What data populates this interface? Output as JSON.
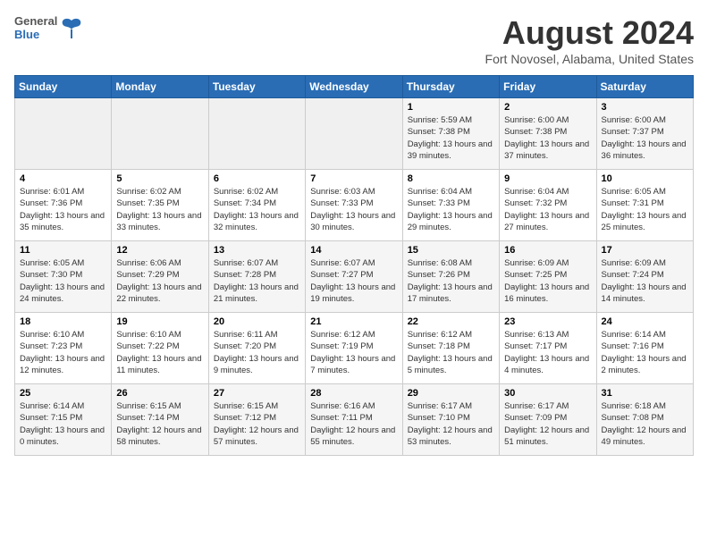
{
  "header": {
    "logo_line1": "General",
    "logo_line2": "Blue",
    "month": "August 2024",
    "location": "Fort Novosel, Alabama, United States"
  },
  "weekdays": [
    "Sunday",
    "Monday",
    "Tuesday",
    "Wednesday",
    "Thursday",
    "Friday",
    "Saturday"
  ],
  "weeks": [
    [
      {
        "day": "",
        "empty": true
      },
      {
        "day": "",
        "empty": true
      },
      {
        "day": "",
        "empty": true
      },
      {
        "day": "",
        "empty": true
      },
      {
        "day": "1",
        "sunrise": "5:59 AM",
        "sunset": "7:38 PM",
        "daylight": "13 hours and 39 minutes."
      },
      {
        "day": "2",
        "sunrise": "6:00 AM",
        "sunset": "7:38 PM",
        "daylight": "13 hours and 37 minutes."
      },
      {
        "day": "3",
        "sunrise": "6:00 AM",
        "sunset": "7:37 PM",
        "daylight": "13 hours and 36 minutes."
      }
    ],
    [
      {
        "day": "4",
        "sunrise": "6:01 AM",
        "sunset": "7:36 PM",
        "daylight": "13 hours and 35 minutes."
      },
      {
        "day": "5",
        "sunrise": "6:02 AM",
        "sunset": "7:35 PM",
        "daylight": "13 hours and 33 minutes."
      },
      {
        "day": "6",
        "sunrise": "6:02 AM",
        "sunset": "7:34 PM",
        "daylight": "13 hours and 32 minutes."
      },
      {
        "day": "7",
        "sunrise": "6:03 AM",
        "sunset": "7:33 PM",
        "daylight": "13 hours and 30 minutes."
      },
      {
        "day": "8",
        "sunrise": "6:04 AM",
        "sunset": "7:33 PM",
        "daylight": "13 hours and 29 minutes."
      },
      {
        "day": "9",
        "sunrise": "6:04 AM",
        "sunset": "7:32 PM",
        "daylight": "13 hours and 27 minutes."
      },
      {
        "day": "10",
        "sunrise": "6:05 AM",
        "sunset": "7:31 PM",
        "daylight": "13 hours and 25 minutes."
      }
    ],
    [
      {
        "day": "11",
        "sunrise": "6:05 AM",
        "sunset": "7:30 PM",
        "daylight": "13 hours and 24 minutes."
      },
      {
        "day": "12",
        "sunrise": "6:06 AM",
        "sunset": "7:29 PM",
        "daylight": "13 hours and 22 minutes."
      },
      {
        "day": "13",
        "sunrise": "6:07 AM",
        "sunset": "7:28 PM",
        "daylight": "13 hours and 21 minutes."
      },
      {
        "day": "14",
        "sunrise": "6:07 AM",
        "sunset": "7:27 PM",
        "daylight": "13 hours and 19 minutes."
      },
      {
        "day": "15",
        "sunrise": "6:08 AM",
        "sunset": "7:26 PM",
        "daylight": "13 hours and 17 minutes."
      },
      {
        "day": "16",
        "sunrise": "6:09 AM",
        "sunset": "7:25 PM",
        "daylight": "13 hours and 16 minutes."
      },
      {
        "day": "17",
        "sunrise": "6:09 AM",
        "sunset": "7:24 PM",
        "daylight": "13 hours and 14 minutes."
      }
    ],
    [
      {
        "day": "18",
        "sunrise": "6:10 AM",
        "sunset": "7:23 PM",
        "daylight": "13 hours and 12 minutes."
      },
      {
        "day": "19",
        "sunrise": "6:10 AM",
        "sunset": "7:22 PM",
        "daylight": "13 hours and 11 minutes."
      },
      {
        "day": "20",
        "sunrise": "6:11 AM",
        "sunset": "7:20 PM",
        "daylight": "13 hours and 9 minutes."
      },
      {
        "day": "21",
        "sunrise": "6:12 AM",
        "sunset": "7:19 PM",
        "daylight": "13 hours and 7 minutes."
      },
      {
        "day": "22",
        "sunrise": "6:12 AM",
        "sunset": "7:18 PM",
        "daylight": "13 hours and 5 minutes."
      },
      {
        "day": "23",
        "sunrise": "6:13 AM",
        "sunset": "7:17 PM",
        "daylight": "13 hours and 4 minutes."
      },
      {
        "day": "24",
        "sunrise": "6:14 AM",
        "sunset": "7:16 PM",
        "daylight": "13 hours and 2 minutes."
      }
    ],
    [
      {
        "day": "25",
        "sunrise": "6:14 AM",
        "sunset": "7:15 PM",
        "daylight": "13 hours and 0 minutes."
      },
      {
        "day": "26",
        "sunrise": "6:15 AM",
        "sunset": "7:14 PM",
        "daylight": "12 hours and 58 minutes."
      },
      {
        "day": "27",
        "sunrise": "6:15 AM",
        "sunset": "7:12 PM",
        "daylight": "12 hours and 57 minutes."
      },
      {
        "day": "28",
        "sunrise": "6:16 AM",
        "sunset": "7:11 PM",
        "daylight": "12 hours and 55 minutes."
      },
      {
        "day": "29",
        "sunrise": "6:17 AM",
        "sunset": "7:10 PM",
        "daylight": "12 hours and 53 minutes."
      },
      {
        "day": "30",
        "sunrise": "6:17 AM",
        "sunset": "7:09 PM",
        "daylight": "12 hours and 51 minutes."
      },
      {
        "day": "31",
        "sunrise": "6:18 AM",
        "sunset": "7:08 PM",
        "daylight": "12 hours and 49 minutes."
      }
    ]
  ],
  "labels": {
    "sunrise": "Sunrise:",
    "sunset": "Sunset:",
    "daylight": "Daylight:"
  }
}
